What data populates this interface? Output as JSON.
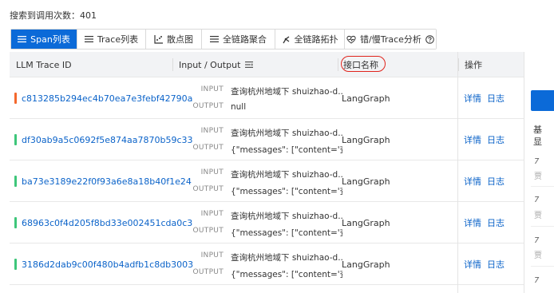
{
  "search_count": "搜索到调用次数：401",
  "tabs": [
    {
      "label": "Span列表",
      "icon": "list-icon",
      "active": true
    },
    {
      "label": "Trace列表",
      "icon": "list-icon",
      "active": false
    },
    {
      "label": "散点图",
      "icon": "scatter-icon",
      "active": false
    },
    {
      "label": "全链路聚合",
      "icon": "list-icon",
      "active": false
    },
    {
      "label": "全链路拓扑",
      "icon": "topology-icon",
      "active": false
    },
    {
      "label": "错/慢Trace分析",
      "icon": "heart-pulse-icon",
      "active": false
    }
  ],
  "table": {
    "headers": {
      "trace_id": "LLM Trace ID",
      "io": "Input / Output",
      "iface": "接口名称",
      "ops": "操作"
    },
    "input_label": "INPUT",
    "output_label": "OUTPUT",
    "rows": [
      {
        "trace_id": "c813285b294ec4b70ea7e3febf42790a",
        "status_color": "#f4682d",
        "input": "查询杭州地域下 shuizhao-d...",
        "output": "null",
        "iface": "LangGraph",
        "detail": "详情",
        "log": "日志"
      },
      {
        "trace_id": "df30ab9a5c0692f5e874aa7870b59c33",
        "status_color": "#3ec67a",
        "input": "查询杭州地域下 shuizhao-d...",
        "output": "{\"messages\": [\"content='查...",
        "iface": "LangGraph",
        "detail": "详情",
        "log": "日志"
      },
      {
        "trace_id": "ba73e3189e22f0f93a6e8a18b40f1e24",
        "status_color": "#3ec67a",
        "input": "查询杭州地域下 shuizhao-d...",
        "output": "{\"messages\": [\"content='查...",
        "iface": "LangGraph",
        "detail": "详情",
        "log": "日志"
      },
      {
        "trace_id": "68963c0f4d205f8bd33e002451cda0c3",
        "status_color": "#3ec67a",
        "input": "查询杭州地域下 shuizhao-d...",
        "output": "{\"messages\": [\"content='查...",
        "iface": "LangGraph",
        "detail": "详情",
        "log": "日志"
      },
      {
        "trace_id": "3186d2dab9c00f480b4adfb1c8db3003",
        "status_color": "#3ec67a",
        "input": "查询杭州地域下 shuizhao-d...",
        "output": "{\"messages\": [\"content='查...",
        "iface": "LangGraph",
        "detail": "详情",
        "log": "日志"
      }
    ]
  },
  "side_panel": {
    "text1": "基",
    "text2": "显",
    "items": [
      {
        "num": "7",
        "sub": "贾"
      },
      {
        "num": "7",
        "sub": "贾"
      },
      {
        "num": "7",
        "sub": "贾"
      },
      {
        "num": "7",
        "sub": ""
      }
    ]
  },
  "colors": {
    "accent": "#0b6ad8",
    "link": "#0b63c9",
    "highlight": "#e0241c"
  }
}
